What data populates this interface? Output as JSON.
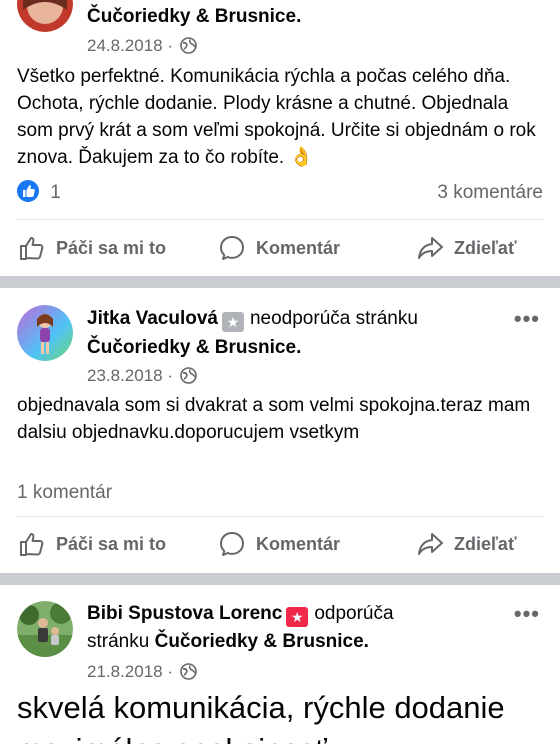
{
  "posts": [
    {
      "author": "",
      "verb": "",
      "page": "Čučoriedky & Brusnice.",
      "date": "24.8.2018 ·",
      "body": "Všetko perfektné. Komunikácia rýchla a počas celého dňa. Ochota, rýchle dodanie. Plody krásne a chutné. Objednala som prvý krát a som veľmi spokojná. Určite si objednám o rok znova. Ďakujem za to čo robíte. 👌",
      "likes": "1",
      "comments": "3 komentáre"
    },
    {
      "author": "Jitka Vaculová",
      "verb": "neodporúča stránku",
      "page": "Čučoriedky & Brusnice.",
      "date": "23.8.2018 ·",
      "body": "objednavala som si dvakrat a som velmi spokojna.teraz mam dalsiu objednavku.doporucujem vsetkym",
      "comments": "1 komentár"
    },
    {
      "author": "Bibi Spustova Lorenc",
      "verb": "odporúča",
      "verb2": "stránku",
      "page": "Čučoriedky & Brusnice.",
      "date": "21.8.2018 ·",
      "body": "skvelá komunikácia, rýchle dodanie",
      "body2": "maximálna spokojnosť"
    }
  ],
  "actions": {
    "like": "Páči sa mi to",
    "comment": "Komentár",
    "share": "Zdieľať"
  },
  "more_label": "•••",
  "colors": {
    "accent": "#1877f2",
    "negative_star": "#b0b3b8",
    "positive_star": "#f02849",
    "separator": "#cacdd2"
  }
}
